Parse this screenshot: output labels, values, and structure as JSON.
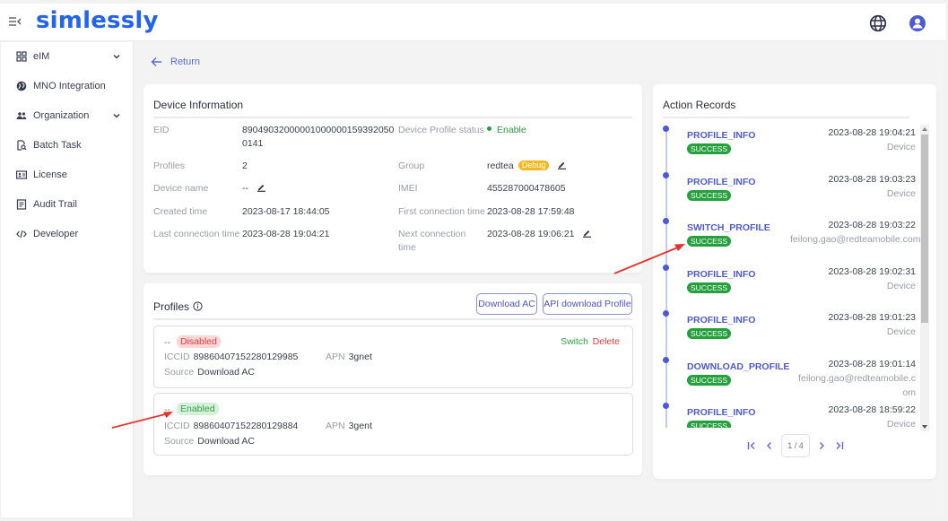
{
  "header": {
    "logo": "simlessly",
    "icons": [
      "menu-collapse-icon",
      "globe-icon",
      "user-icon"
    ]
  },
  "sidebar": {
    "items": [
      {
        "label": "eIM",
        "icon": "grid-icon",
        "expandable": true
      },
      {
        "label": "MNO Integration",
        "icon": "globe-icon",
        "expandable": false
      },
      {
        "label": "Organization",
        "icon": "users-icon",
        "expandable": true
      },
      {
        "label": "Batch Task",
        "icon": "doc-search-icon",
        "expandable": false
      },
      {
        "label": "License",
        "icon": "id-card-icon",
        "expandable": false
      },
      {
        "label": "Audit Trail",
        "icon": "list-doc-icon",
        "expandable": false
      },
      {
        "label": "Developer",
        "icon": "code-icon",
        "expandable": false
      }
    ]
  },
  "nav": {
    "return_label": "Return"
  },
  "device_info": {
    "title": "Device Information",
    "eid_label": "EID",
    "eid_line1": "89049032000001000000159392050",
    "eid_line2": "0141",
    "profiles_label": "Profiles",
    "profiles_value": "2",
    "device_name_label": "Device name",
    "device_name_value": "--",
    "created_label": "Created time",
    "created_value": "2023-08-17 18:44:05",
    "last_conn_label": "Last connection time",
    "last_conn_value": "2023-08-28 19:04:21",
    "status_label": "Device Profile status",
    "status_value": "Enable",
    "group_label": "Group",
    "group_value": "redtea",
    "group_badge": "Debug",
    "imei_label": "IMEI",
    "imei_value": "455287000478605",
    "first_conn_label": "First connection time",
    "first_conn_value": "2023-08-28 17:59:48",
    "next_conn_label_1": "Next connection",
    "next_conn_label_2": "time",
    "next_conn_value": "2023-08-28 19:06:21"
  },
  "profiles": {
    "title": "Profiles",
    "download_ac_button": "Download AC",
    "api_download_button": "API download Profile",
    "iccid_label": "ICCID",
    "apn_label": "APN",
    "source_label": "Source",
    "items": [
      {
        "name": "--",
        "status": "Disabled",
        "iccid": "89860407152280129985",
        "apn": "3gnet",
        "source": "Download AC",
        "switch": "Switch",
        "delete": "Delete"
      },
      {
        "name": "--",
        "status": "Enabled",
        "iccid": "89860407152280129884",
        "apn": "3gent",
        "source": "Download AC"
      }
    ]
  },
  "action_records": {
    "title": "Action Records",
    "items": [
      {
        "action": "PROFILE_INFO",
        "status": "SUCCESS",
        "time": "2023-08-28 19:04:21",
        "actor": "Device"
      },
      {
        "action": "PROFILE_INFO",
        "status": "SUCCESS",
        "time": "2023-08-28 19:03:23",
        "actor": "Device"
      },
      {
        "action": "SWITCH_PROFILE",
        "status": "SUCCESS",
        "time": "2023-08-28 19:03:22",
        "actor": "feilong.gao@redteamobile.com"
      },
      {
        "action": "PROFILE_INFO",
        "status": "SUCCESS",
        "time": "2023-08-28 19:02:31",
        "actor": "Device"
      },
      {
        "action": "PROFILE_INFO",
        "status": "SUCCESS",
        "time": "2023-08-28 19:01:23",
        "actor": "Device"
      },
      {
        "action": "DOWNLOAD_PROFILE",
        "status": "SUCCESS",
        "time": "2023-08-28 19:01:14",
        "actor": "feilong.gao@redteamobile.c",
        "actor2": "om"
      },
      {
        "action": "PROFILE_INFO",
        "status": "SUCCESS",
        "time": "2023-08-28 18:59:22",
        "actor": "Device"
      }
    ],
    "pagination": {
      "current": 1,
      "total": 4,
      "label": "1 / 4"
    }
  },
  "colors": {
    "brand": "#2463eb",
    "accent": "#4e5bd0",
    "success": "#24a03c",
    "danger": "#e33c3c",
    "warning": "#f3b91f",
    "annotation_arrow": "#e8322a"
  }
}
